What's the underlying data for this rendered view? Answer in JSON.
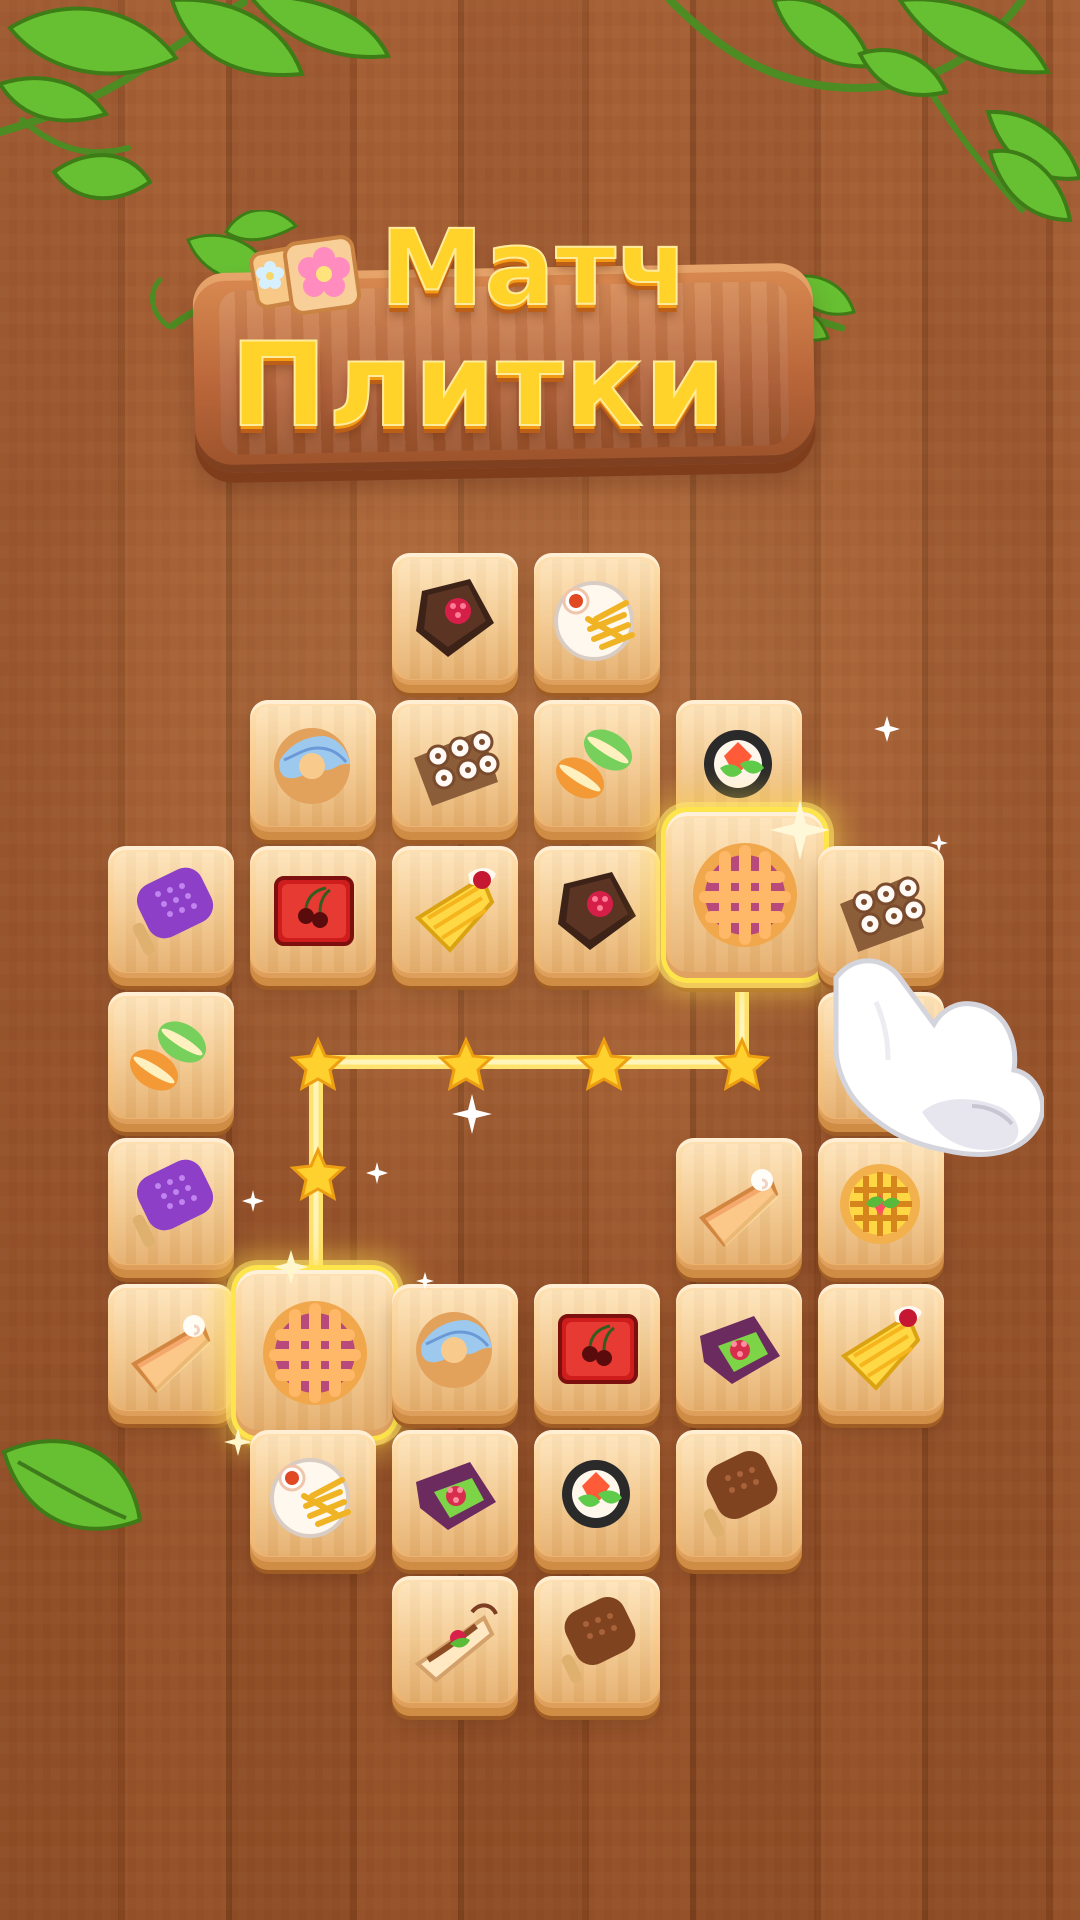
{
  "app": {
    "title_line_1": "Матч",
    "title_line_2": "Плитки"
  },
  "colors": {
    "wood_light": "#a2592d",
    "wood_dark": "#874720",
    "title_yellow": "#ffd32a",
    "title_orange": "#f39a15",
    "tile_face": "#f8cb8d",
    "tile_edge": "#cf8c45",
    "highlight": "#ffe54c",
    "leaf_green": "#64ba2f"
  },
  "board": {
    "selected_pair": [
      "pie-lattice",
      "pie-lattice"
    ],
    "path_icon": "star-icon",
    "tiles": [
      {
        "name": "tile-brownie-top",
        "icon": "brownie-icon"
      },
      {
        "name": "tile-fries-top",
        "icon": "fries-plate-icon"
      },
      {
        "name": "tile-donut-1",
        "icon": "donut-icon"
      },
      {
        "name": "tile-sushi-1",
        "icon": "sushi-plate-icon"
      },
      {
        "name": "tile-macarons-1",
        "icon": "macarons-icon"
      },
      {
        "name": "tile-berry-bowl-1",
        "icon": "berry-bowl-icon"
      },
      {
        "name": "tile-popsicle-purple-1",
        "icon": "popsicle-purple-icon"
      },
      {
        "name": "tile-jelly-1",
        "icon": "cherry-jelly-icon"
      },
      {
        "name": "tile-cake-slice-1",
        "icon": "cake-slice-icon"
      },
      {
        "name": "tile-brownie-2",
        "icon": "brownie-icon"
      },
      {
        "name": "tile-pie-selected-right",
        "icon": "pie-lattice-icon"
      },
      {
        "name": "tile-sushi-2",
        "icon": "sushi-plate-icon"
      },
      {
        "name": "tile-macarons-2",
        "icon": "macarons-icon"
      },
      {
        "name": "tile-hidden-under-hand",
        "icon": "blank-tile-icon"
      },
      {
        "name": "tile-popsicle-purple-2",
        "icon": "popsicle-purple-icon"
      },
      {
        "name": "tile-pumpkin-pie-1",
        "icon": "pumpkin-slice-icon"
      },
      {
        "name": "tile-strawberry-tart-1",
        "icon": "strawberry-tart-icon"
      },
      {
        "name": "tile-pumpkin-pie-2",
        "icon": "pumpkin-slice-icon"
      },
      {
        "name": "tile-pie-selected-left",
        "icon": "pie-lattice-icon"
      },
      {
        "name": "tile-donut-2",
        "icon": "donut-icon"
      },
      {
        "name": "tile-jelly-2",
        "icon": "cherry-jelly-icon"
      },
      {
        "name": "tile-kiwi-brownie-1",
        "icon": "kiwi-brownie-icon"
      },
      {
        "name": "tile-cake-slice-2",
        "icon": "cake-slice-icon"
      },
      {
        "name": "tile-fries-bottom",
        "icon": "fries-plate-icon"
      },
      {
        "name": "tile-kiwi-brownie-2",
        "icon": "kiwi-brownie-icon"
      },
      {
        "name": "tile-berry-bowl-2",
        "icon": "berry-bowl-icon"
      },
      {
        "name": "tile-popsicle-choc-1",
        "icon": "popsicle-chocolate-icon"
      },
      {
        "name": "tile-waffle-slice",
        "icon": "dessert-slice-icon"
      },
      {
        "name": "tile-popsicle-choc-2",
        "icon": "popsicle-chocolate-icon"
      }
    ]
  },
  "decor": {
    "leaf_icon": "leaf-icon",
    "hand_icon": "pointing-hand-icon",
    "sparkle_icon": "sparkle-icon",
    "flower_icon": "flower-icon"
  }
}
